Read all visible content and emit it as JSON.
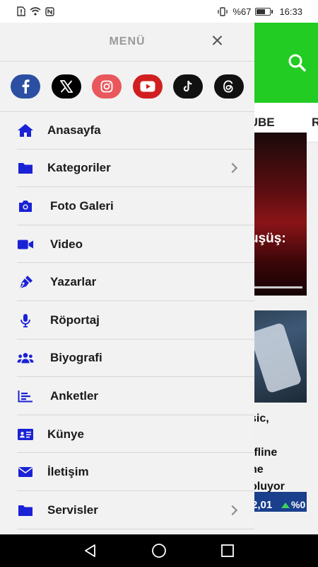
{
  "status_bar": {
    "battery_text": "%67",
    "battery_level": 0.67,
    "time": "16:33"
  },
  "background": {
    "nav_item_partial": "UTUBE",
    "nav_item_partial2": "R",
    "card1_text": "uşüş:",
    "card2_lines": [
      "sic,",
      "ffline",
      "ne",
      "oluyor"
    ],
    "ticker_value": "2,01",
    "ticker_pct": "%0",
    "header_color": "#22cc22"
  },
  "drawer": {
    "title": "MENÜ",
    "social": [
      {
        "name": "facebook-icon",
        "color": "#2c4fa3"
      },
      {
        "name": "x-icon",
        "color": "#000000"
      },
      {
        "name": "instagram-icon",
        "color": "#e8585c"
      },
      {
        "name": "youtube-icon",
        "color": "#d11f1f"
      },
      {
        "name": "tiktok-icon",
        "color": "#111111"
      },
      {
        "name": "threads-icon",
        "color": "#111111"
      }
    ],
    "items": [
      {
        "label": "Anasayfa",
        "icon": "home-icon",
        "chevron": false
      },
      {
        "label": "Kategoriler",
        "icon": "folder-icon",
        "chevron": true
      },
      {
        "label": "Foto Galeri",
        "icon": "camera-icon",
        "chevron": false
      },
      {
        "label": "Video",
        "icon": "video-icon",
        "chevron": false
      },
      {
        "label": "Yazarlar",
        "icon": "pen-icon",
        "chevron": false
      },
      {
        "label": "Röportaj",
        "icon": "microphone-icon",
        "chevron": false
      },
      {
        "label": "Biyografi",
        "icon": "users-icon",
        "chevron": false
      },
      {
        "label": "Anketler",
        "icon": "chart-icon",
        "chevron": false
      },
      {
        "label": "Künye",
        "icon": "id-card-icon",
        "chevron": false
      },
      {
        "label": "İletişim",
        "icon": "envelope-icon",
        "chevron": false
      },
      {
        "label": "Servisler",
        "icon": "folder-icon",
        "chevron": true
      }
    ],
    "icon_color": "#1a22d6"
  }
}
